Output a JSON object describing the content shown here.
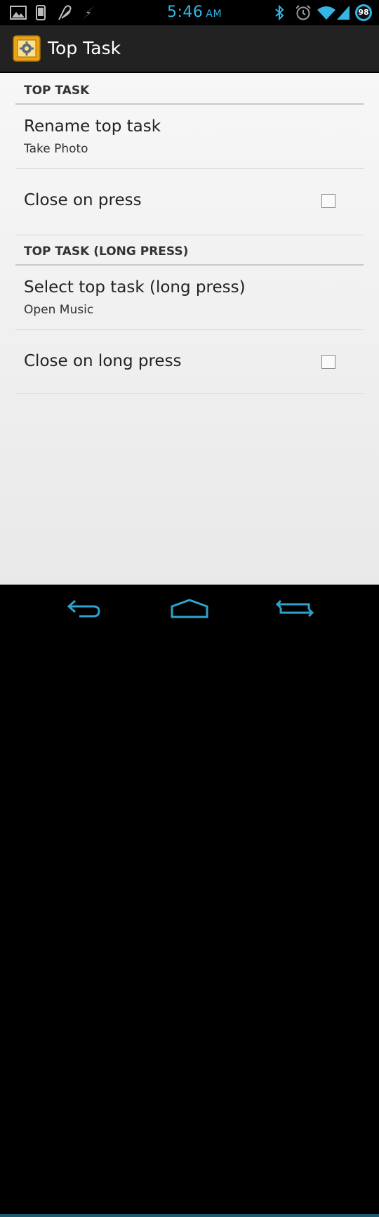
{
  "status_bar": {
    "time": "5:46",
    "ampm": "AM",
    "battery_level": "98",
    "icons": [
      "gallery-icon",
      "phone-icon",
      "signature-icon",
      "lightning-icon",
      "bluetooth-icon",
      "alarm-icon",
      "wifi-icon",
      "cell-signal-icon",
      "battery-icon"
    ]
  },
  "action_bar": {
    "title": "Top Task",
    "icon": "settings-gear-icon"
  },
  "sections": [
    {
      "header": "TOP TASK",
      "items": [
        {
          "title": "Rename top task",
          "summary": "Take Photo"
        },
        {
          "title": "Close on press",
          "checked": false
        }
      ]
    },
    {
      "header": "TOP TASK (LONG PRESS)",
      "items": [
        {
          "title": "Select top task (long press)",
          "summary": "Open Music"
        },
        {
          "title": "Close on long press",
          "checked": false
        }
      ]
    }
  ],
  "nav_bar": {
    "icons": [
      "back-icon",
      "home-icon",
      "recent-apps-icon"
    ]
  },
  "colors": {
    "accent": "#33b5e5",
    "action_bar": "#222222",
    "background": "#f2f2f2"
  }
}
